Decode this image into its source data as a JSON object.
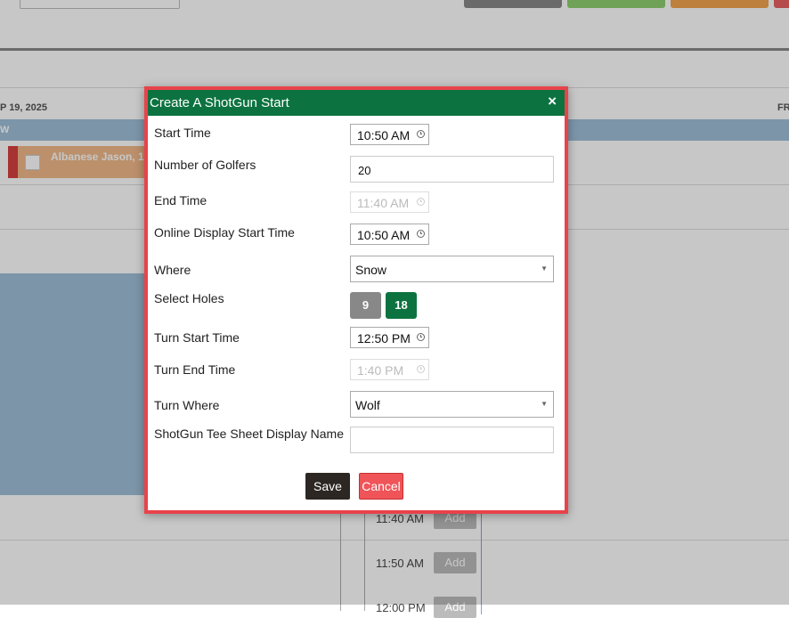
{
  "background": {
    "date_left": "P 19, 2025",
    "date_right": "FR",
    "band_text": "W",
    "booking_name": "Albanese Jason, 1",
    "slots": [
      {
        "time": "11:40 AM",
        "add_label": "Add"
      },
      {
        "time": "11:50 AM",
        "add_label": "Add"
      },
      {
        "time": "12:00 PM",
        "add_label": "Add"
      }
    ]
  },
  "modal": {
    "title": "Create A ShotGun Start",
    "close_symbol": "×",
    "fields": {
      "start_time": {
        "label": "Start Time",
        "value": "10:50 AM"
      },
      "num_golfers": {
        "label": "Number of Golfers",
        "value": "20"
      },
      "end_time": {
        "label": "End Time",
        "value": "11:40 AM"
      },
      "online_display_start": {
        "label": "Online Display Start Time",
        "value": "10:50 AM"
      },
      "where": {
        "label": "Where",
        "value": "Snow"
      },
      "select_holes": {
        "label": "Select Holes",
        "options": [
          "9",
          "18"
        ],
        "selected": "18"
      },
      "turn_start_time": {
        "label": "Turn Start Time",
        "value": "12:50 PM"
      },
      "turn_end_time": {
        "label": "Turn End Time",
        "value": "1:40 PM"
      },
      "turn_where": {
        "label": "Turn Where",
        "value": "Wolf"
      },
      "display_name": {
        "label": "ShotGun Tee Sheet Display Name",
        "value": ""
      }
    },
    "save_label": "Save",
    "cancel_label": "Cancel"
  },
  "colors": {
    "header": "#0c7340",
    "modal_border": "#e8434a",
    "save": "#2c2722",
    "cancel": "#ef5459",
    "hole_selected": "#0c7340",
    "hole_unselected": "#888888"
  },
  "icons": {
    "time_picker": "clock-icon",
    "select": "caret-down-icon",
    "close": "close-icon"
  }
}
